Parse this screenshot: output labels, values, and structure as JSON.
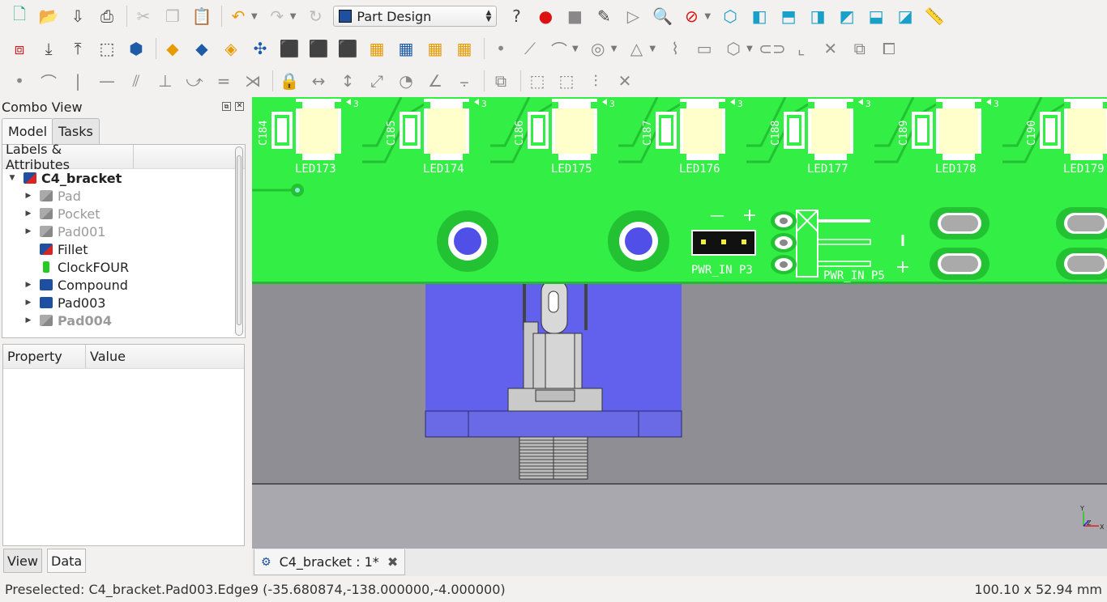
{
  "toolbar": {
    "workbench": "Part Design"
  },
  "combo_view": {
    "title": "Combo View",
    "tabs": [
      "Model",
      "Tasks"
    ],
    "tree_header": "Labels & Attributes",
    "tree": [
      {
        "label": "C4_bracket",
        "bold": true,
        "expanded": true,
        "icon": "body-icon"
      },
      {
        "label": "Pad",
        "grayed": true,
        "icon": "pad-icon"
      },
      {
        "label": "Pocket",
        "grayed": true,
        "icon": "pocket-icon"
      },
      {
        "label": "Pad001",
        "grayed": true,
        "icon": "pad-icon"
      },
      {
        "label": "Fillet",
        "grayed": false,
        "icon": "fillet-icon"
      },
      {
        "label": "ClockFOUR",
        "grayed": false,
        "icon": "sketch-icon"
      },
      {
        "label": "Compound",
        "grayed": false,
        "icon": "compound-icon"
      },
      {
        "label": "Pad003",
        "grayed": false,
        "icon": "pad-icon"
      },
      {
        "label": "Pad004",
        "grayed": true,
        "icon": "pad-icon"
      }
    ],
    "property_headers": [
      "Property",
      "Value"
    ],
    "bottom_tabs": [
      "View",
      "Data"
    ]
  },
  "viewport": {
    "leds": [
      {
        "cap": "C184",
        "led": "LED173"
      },
      {
        "cap": "C185",
        "led": "LED174"
      },
      {
        "cap": "C186",
        "led": "LED175"
      },
      {
        "cap": "C187",
        "led": "LED176"
      },
      {
        "cap": "C188",
        "led": "LED177"
      },
      {
        "cap": "C189",
        "led": "LED178"
      },
      {
        "cap": "C190",
        "led": "LED179"
      }
    ],
    "pin_mark": "3",
    "p3_label": "PWR_IN  P3",
    "p5_label": "PWR_IN  P5",
    "minus": "—",
    "plus": "+",
    "axis_y": "Y",
    "axis_z": "Z",
    "axis_x": "X",
    "colors": {
      "pcb": "#33ee44",
      "bracket": "#6161ee",
      "ground": "#9b9aa1"
    }
  },
  "document_tab": {
    "label": "C4_bracket : 1*"
  },
  "statusbar": {
    "preselected": "Preselected: C4_bracket.Pad003.Edge9 (-35.680874,-138.000000,-4.000000)",
    "dimensions": "100.10 x 52.94 mm"
  }
}
